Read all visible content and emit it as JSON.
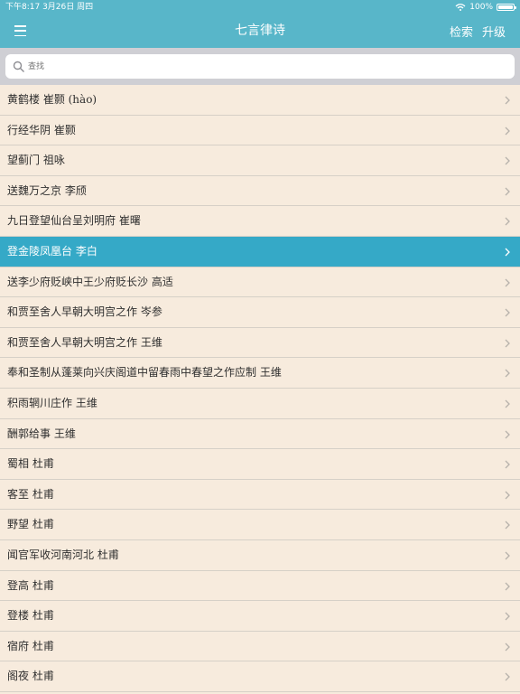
{
  "status_bar": {
    "time_date": "下午8:17  3月26日 周四",
    "battery": "100%"
  },
  "navbar": {
    "title": "七言律诗",
    "search_label": "检索",
    "upgrade_label": "升级"
  },
  "search": {
    "placeholder": "查找"
  },
  "list": {
    "selected_index": 5,
    "items": [
      "黄鹤楼 崔颢 (hào)",
      "行经华阴 崔颢",
      "望蓟门 祖咏",
      "送魏万之京 李颀",
      "九日登望仙台呈刘明府 崔曙",
      "登金陵凤凰台 李白",
      "送李少府贬峡中王少府贬长沙 高适",
      "和贾至舍人早朝大明宫之作 岑参",
      "和贾至舍人早朝大明宫之作 王维",
      "奉和圣制从蓬莱向兴庆阁道中留春雨中春望之作应制 王维",
      "积雨辋川庄作 王维",
      "酬郭给事 王维",
      "蜀相 杜甫",
      "客至 杜甫",
      "野望 杜甫",
      "闻官军收河南河北 杜甫",
      "登高 杜甫",
      "登楼 杜甫",
      "宿府 杜甫",
      "阁夜 杜甫"
    ]
  },
  "colors": {
    "header": "#58b6c9",
    "selected_row": "#35a9c7",
    "list_background": "#f7ebdd"
  }
}
